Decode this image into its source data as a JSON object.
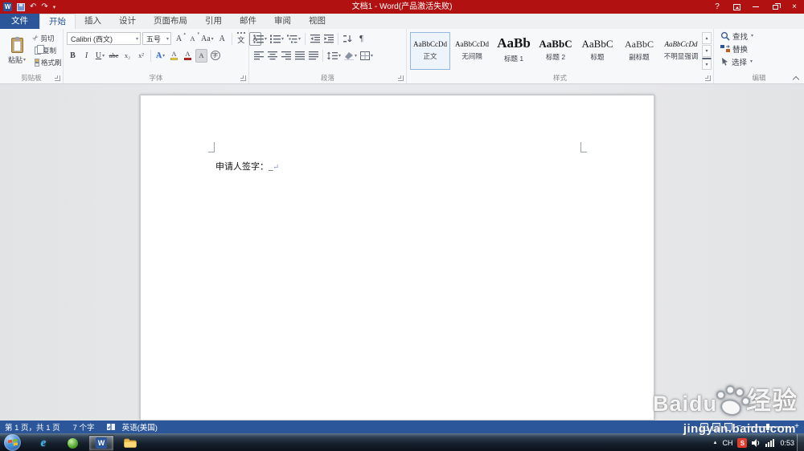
{
  "icons": {
    "caret_down": "▾",
    "caret_up": "▴",
    "undo": "↶",
    "redo": "↷",
    "help": "?",
    "close": "×",
    "pilcrow": "¶",
    "scissors": "✂",
    "bold": "B",
    "italic": "I",
    "underline": "U",
    "strike": "abc",
    "subscript": "x₂",
    "superscript": "x²",
    "grow_font": "A",
    "shrink_font": "A",
    "change_case": "Aa",
    "clear_format": "A",
    "phonetic": "文",
    "char_border": "A",
    "text_effects": "A",
    "highlight": "A",
    "font_color": "A",
    "char_shading": "A",
    "enclose": "字",
    "zoom_out": "−",
    "zoom_in": "+",
    "tray_expand": "▲"
  },
  "titlebar": {
    "logo_letter": "W",
    "title": "文档1 - Word(产品激活失败)"
  },
  "tabs": {
    "file": "文件",
    "items": [
      "开始",
      "插入",
      "设计",
      "页面布局",
      "引用",
      "邮件",
      "审阅",
      "视图"
    ]
  },
  "ribbon": {
    "clipboard": {
      "group": "剪贴板",
      "paste": "粘贴",
      "cut": "剪切",
      "copy": "复制",
      "format_painter": "格式刷"
    },
    "font": {
      "group": "字体",
      "name": "Calibri (西文)",
      "size": "五号"
    },
    "paragraph": {
      "group": "段落"
    },
    "styles": {
      "group": "样式",
      "items": [
        {
          "preview": "AaBbCcDd",
          "name": "正文"
        },
        {
          "preview": "AaBbCcDd",
          "name": "无间隔"
        },
        {
          "preview": "AaBb",
          "name": "标题 1"
        },
        {
          "preview": "AaBbC",
          "name": "标题 2"
        },
        {
          "preview": "AaBbC",
          "name": "标题"
        },
        {
          "preview": "AaBbC",
          "name": "副标题"
        },
        {
          "preview": "AaBbCcDd",
          "name": "不明显强调"
        }
      ]
    },
    "editing": {
      "group": "编辑",
      "find": "查找",
      "replace": "替换",
      "select": "选择"
    }
  },
  "document": {
    "line": "申请人签字：_",
    "mark": "↵"
  },
  "statusbar": {
    "page": "第 1 页，共 1 页",
    "words": "7 个字",
    "language": "英语(美国)"
  },
  "taskbar": {
    "ie_letter": "e",
    "word_letter": "W",
    "lang": "CH",
    "sogou_letter": "S",
    "time": "0:53"
  },
  "watermark": {
    "brand_latin": "Baidu",
    "brand_cjk": "经验",
    "url": "jingyan.baidu.com"
  }
}
